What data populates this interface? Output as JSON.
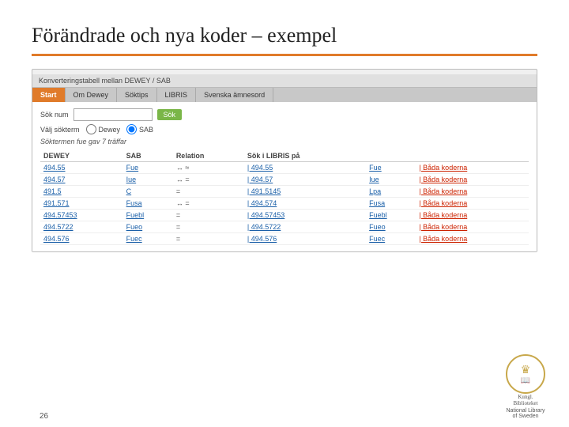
{
  "title": "Förändrade och nya koder – exempel",
  "orange_line": true,
  "browser": {
    "titlebar": "Konverteringstabell mellan DEWEY / SAB",
    "nav_tabs": [
      {
        "label": "Start",
        "active": true
      },
      {
        "label": "Om Dewey",
        "active": false
      },
      {
        "label": "Söktips",
        "active": false
      },
      {
        "label": "LIBRIS",
        "active": false
      },
      {
        "label": "Svenska ämnesord",
        "active": false
      }
    ],
    "search": {
      "label": "Sök num",
      "placeholder": "",
      "button_label": "Sök",
      "radio_label": "Välj sökterm",
      "radio_options": [
        "Dewey",
        "SAB"
      ]
    },
    "result_text": "Söktermen fue gav 7 träffar",
    "table": {
      "headers": [
        "DEWEY",
        "SAB",
        "Relation",
        "Sök i LIBRIS på"
      ],
      "rows": [
        {
          "dewey": "494.55",
          "sab": "Fue",
          "relation": "↔ ≈",
          "libris": "| 494.55",
          "sab2": "Fue",
          "action": "| Båda koderna"
        },
        {
          "dewey": "494.57",
          "sab": "Iue",
          "relation": "↔ =",
          "libris": "| 494.57",
          "sab2": "Iue",
          "action": "| Båda koderna"
        },
        {
          "dewey": "491.5",
          "sab": "C",
          "relation": "=",
          "libris": "| 491.5145",
          "sab2": "Lpa",
          "action": "| Båda koderna"
        },
        {
          "dewey": "491.571",
          "sab": "Fusa",
          "relation": "↔ =",
          "libris": "| 494.574",
          "sab2": "Fusa",
          "action": "| Båda koderna"
        },
        {
          "dewey": "494.57453",
          "sab": "Fuebl",
          "relation": "=",
          "libris": "| 494.57453",
          "sab2": "Fuebl",
          "action": "| Båda koderna"
        },
        {
          "dewey": "494.5722",
          "sab": "Fueo",
          "relation": "=",
          "libris": "| 494.5722",
          "sab2": "Fueo",
          "action": "| Båda koderna"
        },
        {
          "dewey": "494.576",
          "sab": "Fuec",
          "relation": "=",
          "libris": "| 494.576",
          "sab2": "Fuec",
          "action": "| Båda koderna"
        }
      ]
    }
  },
  "page_number": "26",
  "logo": {
    "line1": "Kungl.",
    "line2": "Biblioteket",
    "subtitle": "National Library\nof Sweden"
  }
}
